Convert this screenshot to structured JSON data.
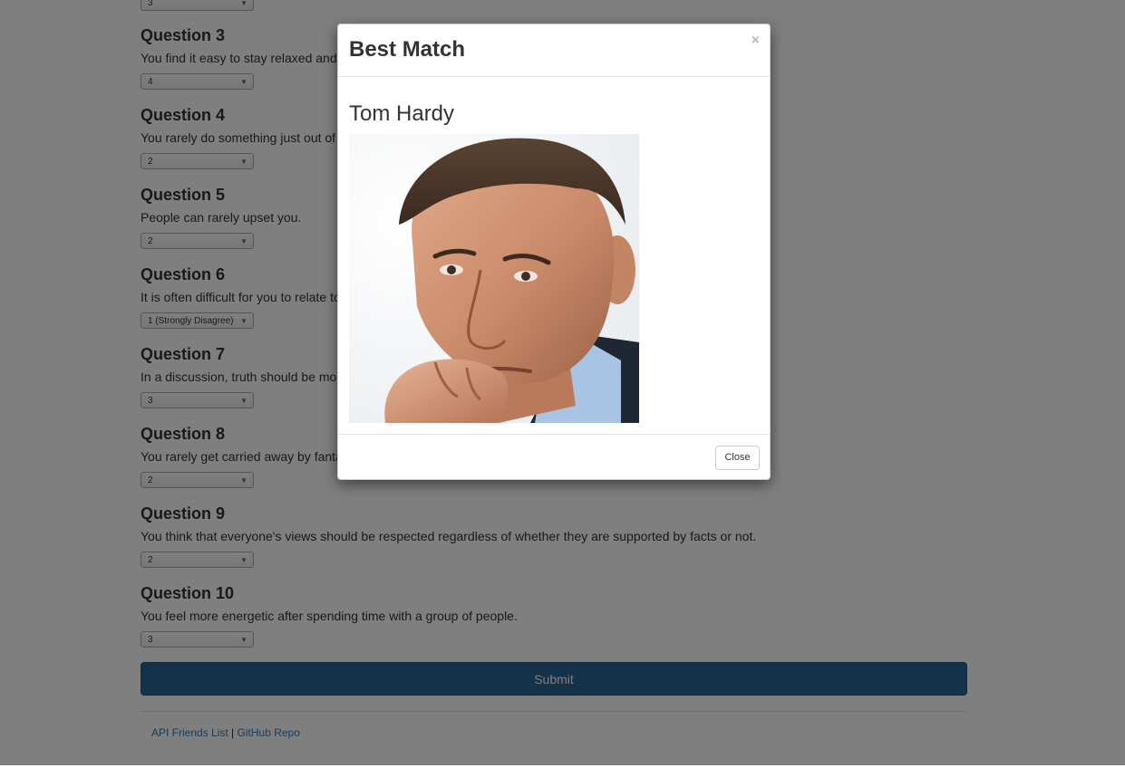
{
  "questions": [
    {
      "title": "Question 3",
      "text": "You find it easy to stay relaxed and focused even when there is some pressure.",
      "selected": "4"
    },
    {
      "title": "Question 4",
      "text": "You rarely do something just out of sheer curiosity.",
      "selected": "2"
    },
    {
      "title": "Question 5",
      "text": "People can rarely upset you.",
      "selected": "2"
    },
    {
      "title": "Question 6",
      "text": "It is often difficult for you to relate to other people's feelings.",
      "selected": "1 (Strongly Disagree)"
    },
    {
      "title": "Question 7",
      "text": "In a discussion, truth should be more important than people's sensitivities.",
      "selected": "3"
    },
    {
      "title": "Question 8",
      "text": "You rarely get carried away by fantasies and ideas.",
      "selected": "2"
    },
    {
      "title": "Question 9",
      "text": "You think that everyone's views should be respected regardless of whether they are supported by facts or not.",
      "selected": "2"
    },
    {
      "title": "Question 10",
      "text": "You feel more energetic after spending time with a group of people.",
      "selected": "3"
    }
  ],
  "previous_select": "3",
  "submit_label": "Submit",
  "footer": {
    "link1": "API Friends List",
    "separator": "|",
    "link2": "GitHub Repo"
  },
  "modal": {
    "title": "Best Match",
    "close_x": "×",
    "match_name": "Tom Hardy",
    "photo": "portrait-photo",
    "close_button": "Close"
  },
  "colors": {
    "submit": "#2a6496",
    "link": "#337ab7",
    "backdrop": "rgba(0,0,0,0.5)"
  }
}
